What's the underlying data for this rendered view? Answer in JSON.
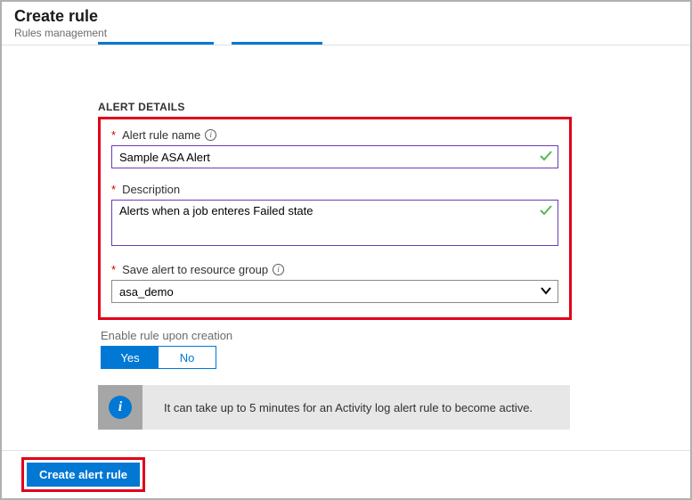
{
  "header": {
    "title": "Create rule",
    "subtitle": "Rules management"
  },
  "alertDetails": {
    "sectionTitle": "ALERT DETAILS",
    "ruleName": {
      "label": "Alert rule name",
      "value": "Sample ASA Alert"
    },
    "description": {
      "label": "Description",
      "value": "Alerts when a job enteres Failed state"
    },
    "resourceGroup": {
      "label": "Save alert to resource group",
      "value": "asa_demo"
    }
  },
  "enableRule": {
    "label": "Enable rule upon creation",
    "yes": "Yes",
    "no": "No"
  },
  "banner": {
    "text": "It can take up to 5 minutes for an Activity log alert rule to become active."
  },
  "footer": {
    "createButton": "Create alert rule"
  }
}
